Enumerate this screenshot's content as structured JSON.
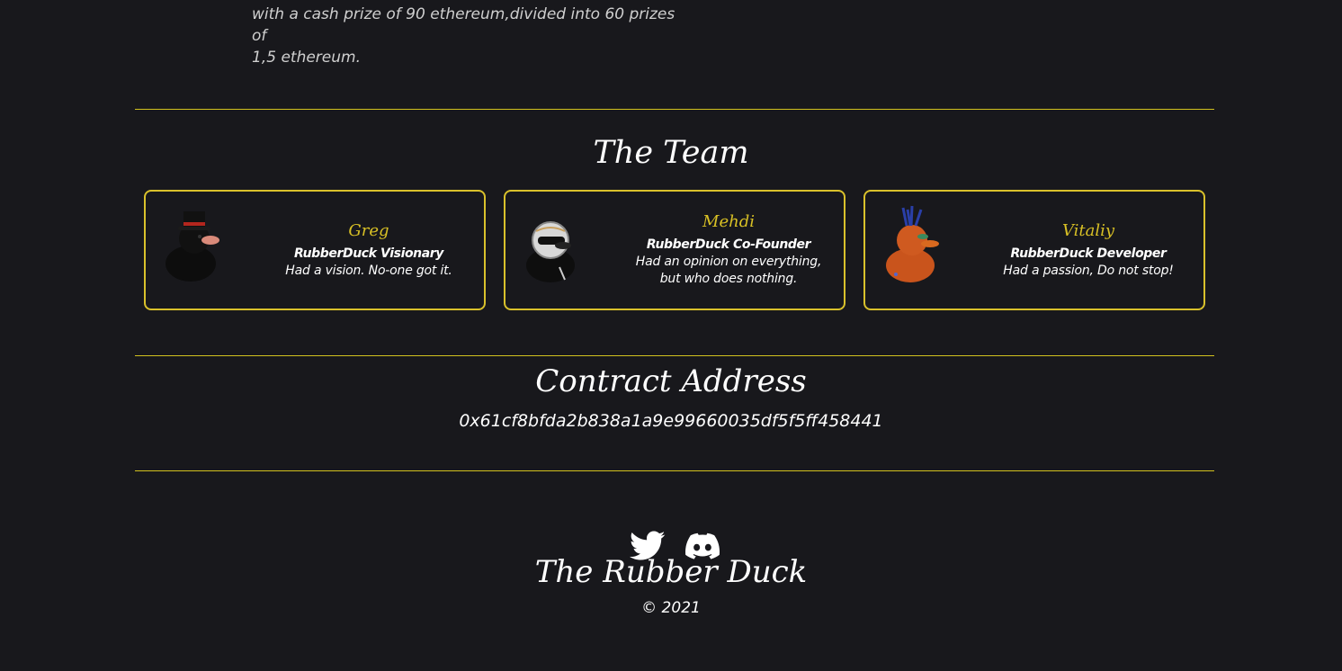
{
  "intro": {
    "line1": "with a cash prize of 90 ethereum,divided into 60 prizes of",
    "line2": "1,5 ethereum."
  },
  "team": {
    "heading": "The Team",
    "members": [
      {
        "name": "Greg",
        "role": "RubberDuck Visionary",
        "desc": "Had a vision. No-one got it.",
        "icon": "top-hat-duck-icon"
      },
      {
        "name": "Mehdi",
        "role": "RubberDuck Co-Founder",
        "desc": "Had an opinion on everything, but who does nothing.",
        "icon": "astronaut-duck-icon"
      },
      {
        "name": "Vitaliy",
        "role": "RubberDuck Developer",
        "desc": "Had a passion, Do not stop!",
        "icon": "punk-duck-icon"
      }
    ]
  },
  "contract": {
    "heading": "Contract Address",
    "address": "0x61cf8bfda2b838a1a9e99660035df5f5ff458441"
  },
  "footer": {
    "title": "The Rubber Duck",
    "copyright": "© 2021",
    "social": [
      "twitter-icon",
      "discord-icon"
    ]
  },
  "colors": {
    "background": "#18181c",
    "accent": "#d9c12b",
    "text": "#ffffff"
  }
}
